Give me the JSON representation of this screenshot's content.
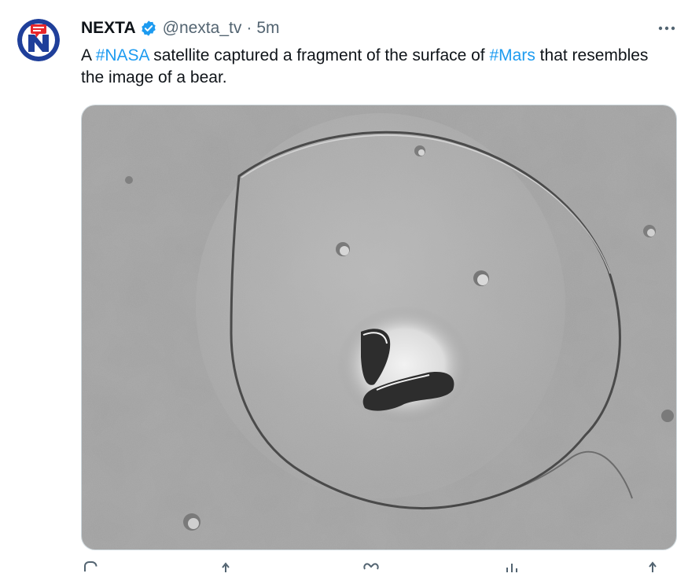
{
  "tweet": {
    "author_name": "NEXTA",
    "handle": "@nexta_tv",
    "separator": "·",
    "time": "5m",
    "more_label": "•••",
    "text_parts": {
      "p1": "A ",
      "tag1": "#NASA",
      "p2": " satellite captured a fragment of the surface of ",
      "tag2": "#Mars",
      "p3": " that resembles the image of a bear."
    },
    "icons": {
      "avatar": "nexta-logo",
      "verified": "verified-badge-icon",
      "more": "more-options-icon",
      "media": "mars-crater-bear-photo"
    },
    "actions": [
      "reply-icon",
      "retweet-icon",
      "like-icon",
      "views-icon",
      "share-icon"
    ],
    "colors": {
      "link": "#1d9bf0",
      "secondary_text": "#536471",
      "primary_text": "#0f1419",
      "avatar_red": "#e8262b",
      "avatar_blue": "#1f3f9a"
    }
  }
}
